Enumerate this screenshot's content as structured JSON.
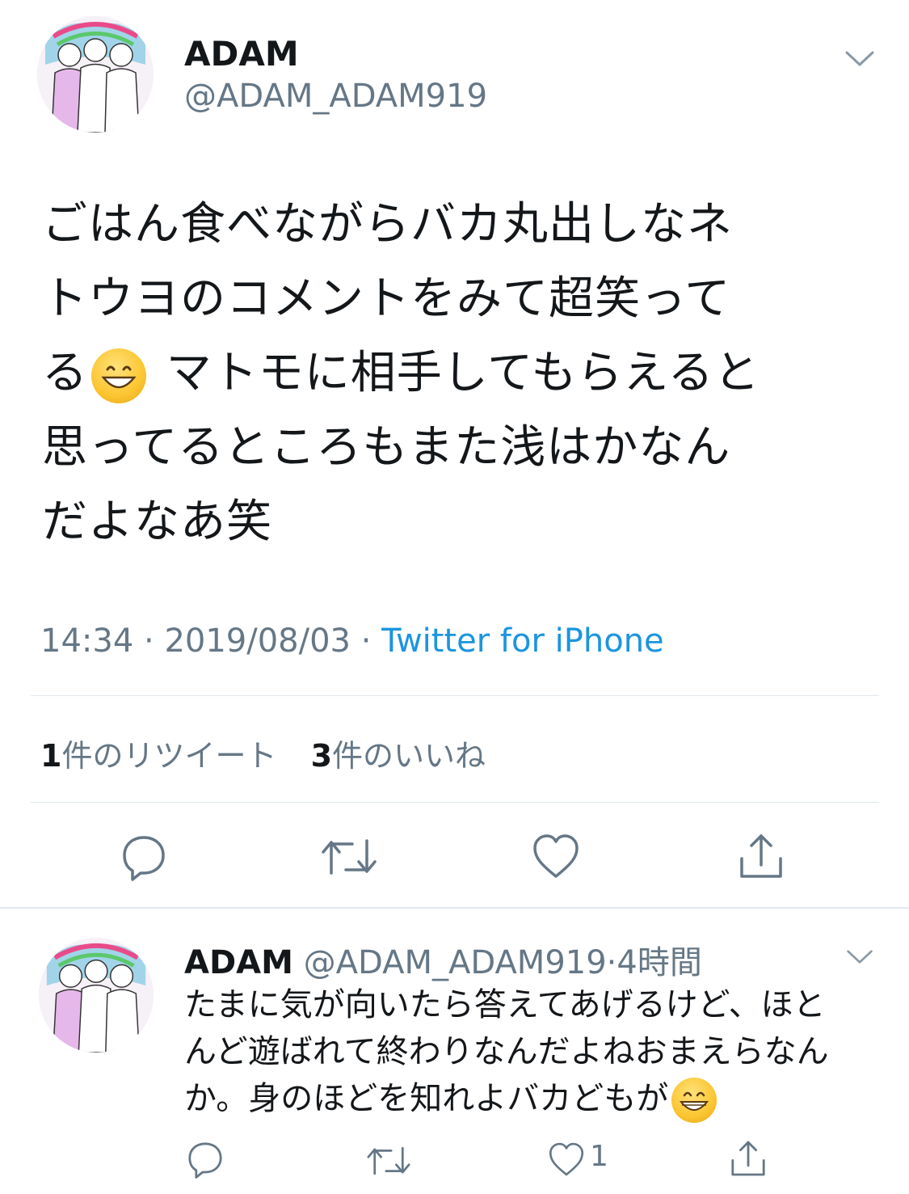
{
  "tweet": {
    "author": {
      "name": "ADAM",
      "handle": "@ADAM_ADAM919"
    },
    "text_lines": [
      "ごはん食べながらバカ丸出しなネ",
      "トウヨのコメントをみて超笑って",
      "る",
      " マトモに相手してもらえると",
      "思ってるところもまた浅はかなん",
      "だよなあ笑"
    ],
    "emoji": "grinning-face",
    "time": "14:34",
    "date": "2019/08/03",
    "separator": "·",
    "source": "Twitter for iPhone",
    "retweet_count": "1",
    "retweet_label": "件のリツイート",
    "like_count": "3",
    "like_label": "件のいいね"
  },
  "reply": {
    "author": {
      "name": "ADAM",
      "handle": "@ADAM_ADAM919"
    },
    "separator": "·",
    "time_ago": "4時間",
    "text_lines": [
      "たまに気が向いたら答えてあげるけど、ほと",
      "んど遊ばれて終わりなんだよねおまえらなん",
      "か。身のほどを知れよバカどもが"
    ],
    "like_count": "1"
  },
  "colors": {
    "text": "#14171a",
    "secondary": "#657786",
    "link": "#1b95e0",
    "divider": "#e1e8ed"
  }
}
